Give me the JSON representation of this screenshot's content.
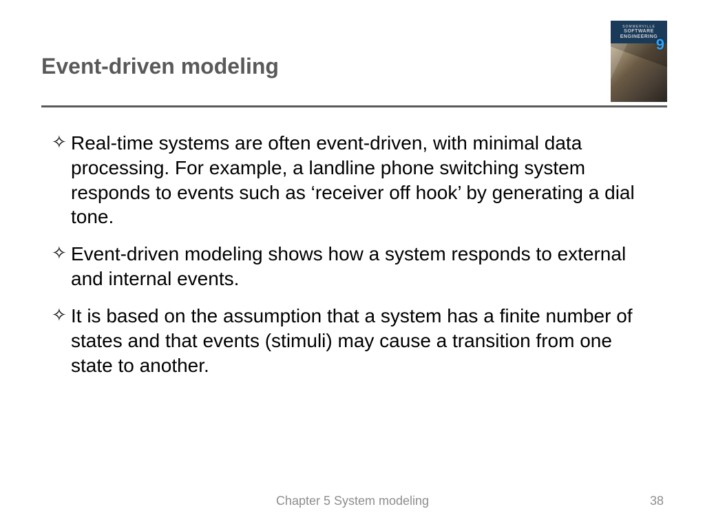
{
  "header": {
    "title": "Event-driven modeling",
    "book_label_small": "SOMMERVILLE",
    "book_label": "SOFTWARE ENGINEERING",
    "book_edition": "9"
  },
  "bullets": [
    "Real-time systems are often event-driven, with minimal data processing. For example, a landline phone switching system responds to events such as ‘receiver off hook’ by generating a dial tone.",
    "Event-driven modeling shows how a system responds to external and internal events.",
    "It is based on the assumption that a system has a finite number of states and that events (stimuli) may cause a transition from one state to another."
  ],
  "bullet_glyph": "✧",
  "footer": {
    "center": "Chapter 5 System modeling",
    "page": "38"
  }
}
